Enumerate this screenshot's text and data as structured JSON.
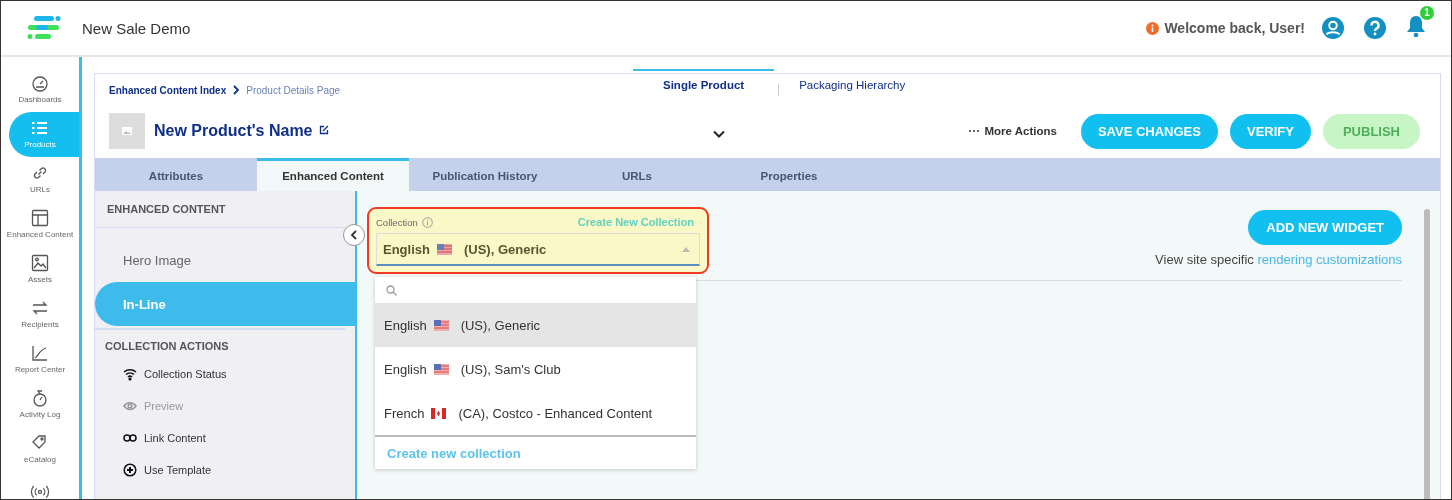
{
  "app": {
    "title": "New Sale Demo",
    "welcome": "Welcome back, User!",
    "notification_count": "1"
  },
  "nav": [
    {
      "label": "Dashboards",
      "selected": false
    },
    {
      "label": "Products",
      "selected": true
    },
    {
      "label": "URLs",
      "selected": false
    },
    {
      "label": "Enhanced Content",
      "selected": false
    },
    {
      "label": "Assets",
      "selected": false
    },
    {
      "label": "Recipients",
      "selected": false
    },
    {
      "label": "Report Center",
      "selected": false
    },
    {
      "label": "Activity Log",
      "selected": false
    },
    {
      "label": "eCatalog",
      "selected": false
    }
  ],
  "breadcrumbs": [
    "Enhanced Content Index",
    "Product Details Page"
  ],
  "view_tabs": [
    {
      "label": "Single Product",
      "selected": true
    },
    {
      "label": "Packaging Hierarchy",
      "selected": false
    }
  ],
  "product": {
    "name": "New Product's Name"
  },
  "more_actions": "More Actions",
  "actions": [
    {
      "label": "SAVE CHANGES",
      "disabled": false
    },
    {
      "label": "VERIFY",
      "disabled": false
    },
    {
      "label": "PUBLISH",
      "disabled": true
    }
  ],
  "tabs": [
    {
      "label": "Attributes",
      "selected": false
    },
    {
      "label": "Enhanced Content",
      "selected": true
    },
    {
      "label": "Publication History",
      "selected": false
    },
    {
      "label": "URLs",
      "selected": false
    },
    {
      "label": "Properties",
      "selected": false
    }
  ],
  "content_panel": {
    "section_title": "ENHANCED CONTENT",
    "items": [
      {
        "label": "Hero Image",
        "selected": false
      },
      {
        "label": "In-Line",
        "selected": true
      }
    ],
    "actions_title": "COLLECTION ACTIONS",
    "actions": [
      {
        "label": "Collection Status",
        "disabled": false,
        "kind": "status"
      },
      {
        "label": "Preview",
        "disabled": true,
        "kind": "preview"
      },
      {
        "label": "Link Content",
        "disabled": false,
        "kind": "link"
      },
      {
        "label": "Use Template",
        "disabled": false,
        "kind": "template"
      }
    ]
  },
  "collection": {
    "label": "Collection",
    "create_link": "Create New Collection",
    "value": {
      "language": "English",
      "kind": "us",
      "region": "(US), Generic"
    },
    "expanded": true,
    "options": [
      {
        "language": "English",
        "kind": "us",
        "region": "(US), Generic",
        "selected": true
      },
      {
        "language": "English",
        "kind": "us",
        "region": "(US), Sam's Club",
        "selected": false
      },
      {
        "language": "French",
        "kind": "ca",
        "region": "(CA), Costco - Enhanced Content",
        "selected": false
      }
    ],
    "footer_link": "Create new collection"
  },
  "widget_button": "ADD NEW WIDGET",
  "rendering_note": {
    "text": "View site specific",
    "link": "rendering customizations"
  }
}
